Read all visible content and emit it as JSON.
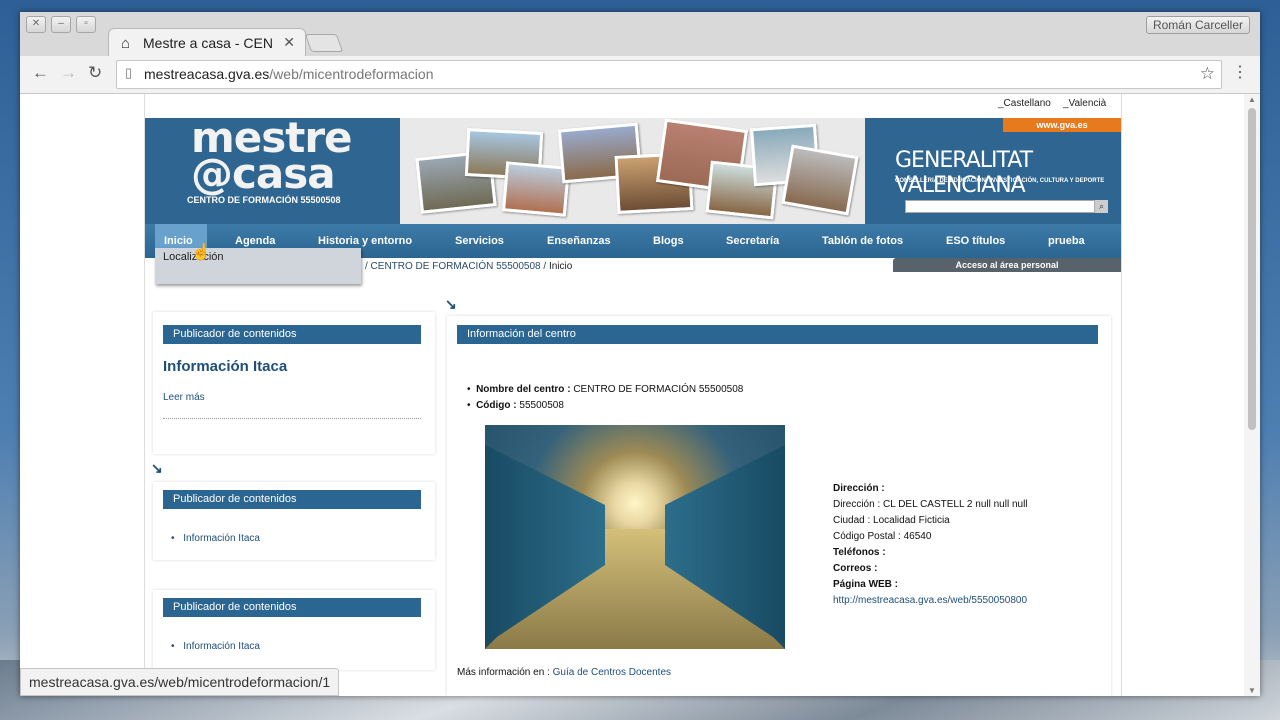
{
  "browser": {
    "tab_title": "Mestre a casa - CEN",
    "user_name": "Román Carceller",
    "url_host": "mestreacasa.gva.es",
    "url_path": "/web/micentrodeformacion",
    "status_url": "mestreacasa.gva.es/web/micentrodeformacion/1"
  },
  "languages": [
    "_Castellano",
    "_Valencià"
  ],
  "header": {
    "logo_line1": "mestre",
    "logo_line2": "@casa",
    "logo_subtitle": "CENTRO DE FORMACIÓN 55500508",
    "gva_link": "www.gva.es",
    "gva_title": "GENERALITAT VALENCIANA",
    "gva_subtitle": "CONSELLERIA DE EDUCACIÓN, INVESTIGACIÓN, CULTURA Y DEPORTE"
  },
  "nav": {
    "items": [
      "Inicio",
      "Agenda",
      "Historia y entorno",
      "Servicios",
      "Enseñanzas",
      "Blogs",
      "Secretaría",
      "Tablón de fotos",
      "ESO títulos",
      "prueba"
    ],
    "dropdown_item": "Localización"
  },
  "breadcrumb": {
    "link": "/ CENTRO DE FORMACIÓN 55500508 /",
    "current": "Inicio"
  },
  "access_label": "Acceso al área personal",
  "left": {
    "portlet1_title": "Publicador de contenidos",
    "portlet1_heading": "Información Itaca",
    "portlet1_more": "Leer más",
    "portlet2_title": "Publicador de contenidos",
    "portlet2_item": "Información Itaca",
    "portlet3_title": "Publicador de contenidos",
    "portlet3_item": "Información Itaca"
  },
  "center": {
    "title": "Información del centro",
    "name_label": "Nombre del centro :",
    "name_value": "CENTRO DE FORMACIÓN 55500508",
    "code_label": "Código :",
    "code_value": "55500508",
    "address_heading": "Dirección :",
    "address_line": "Dirección : CL DEL CASTELL 2 null null null",
    "city_line": "Ciudad : Localidad Ficticia",
    "postal_line": "Código Postal : 46540",
    "phones_label": "Teléfonos :",
    "mail_label": "Correos :",
    "web_label": "Página WEB :",
    "web_url": "http://mestreacasa.gva.es/web/5550050800",
    "more_info_label": "Más información en :",
    "more_info_link": "Guía de Centros Docentes"
  }
}
